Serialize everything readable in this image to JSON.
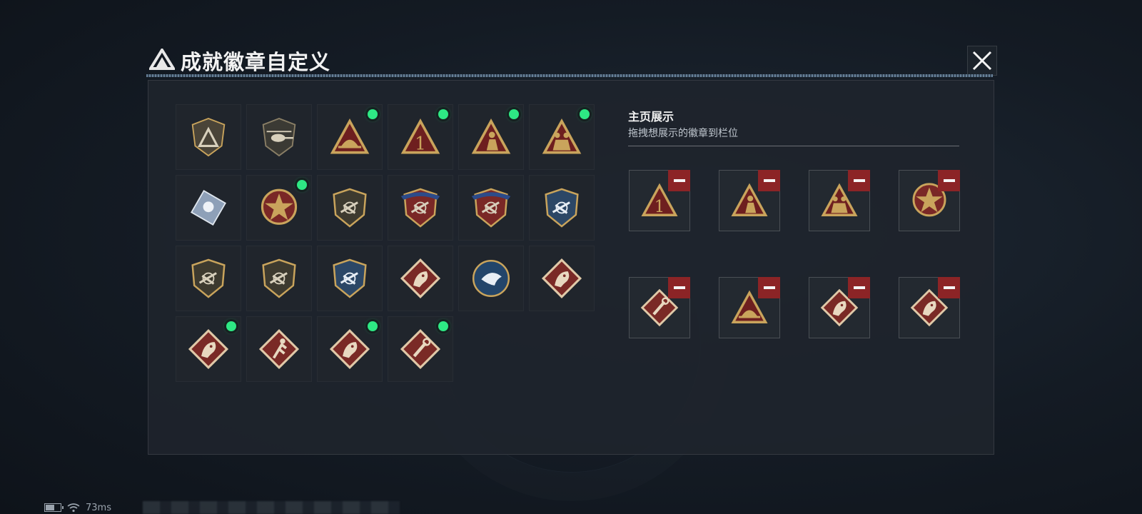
{
  "header": {
    "title": "成就徽章自定义"
  },
  "display": {
    "title": "主页展示",
    "subtitle": "拖拽想展示的徽章到栏位"
  },
  "status": {
    "ping": "73ms"
  },
  "colors": {
    "new_dot": "#2ee884",
    "remove": "#8c2426"
  },
  "badges": [
    {
      "icon": "triangle-shield-badge-icon",
      "new": false
    },
    {
      "icon": "helicopter-badge-icon",
      "new": false
    },
    {
      "icon": "gold-triangle-hat-badge-icon",
      "new": true
    },
    {
      "icon": "gold-triangle-number-one-badge-icon",
      "new": true
    },
    {
      "icon": "gold-triangle-soldier-badge-icon",
      "new": true
    },
    {
      "icon": "gold-triangle-squad-badge-icon",
      "new": true
    },
    {
      "icon": "silver-gem-badge-icon",
      "new": false
    },
    {
      "icon": "star-emblem-badge-icon",
      "new": true
    },
    {
      "icon": "chevron-shield-badge-icon",
      "new": false
    },
    {
      "icon": "winged-star-shield-badge-icon",
      "new": false
    },
    {
      "icon": "red-diamond-shield-badge-icon",
      "new": false
    },
    {
      "icon": "crosshair-rifle-shield-badge-icon",
      "new": false
    },
    {
      "icon": "rifle-shield-badge-icon",
      "new": false
    },
    {
      "icon": "smg-shield-badge-icon",
      "new": false
    },
    {
      "icon": "crossed-bullets-shield-badge-icon",
      "new": false
    },
    {
      "icon": "wolf-diamond-badge-icon",
      "new": false
    },
    {
      "icon": "eagle-medallion-badge-icon",
      "new": false
    },
    {
      "icon": "dragon-diamond-badge-icon",
      "new": false
    },
    {
      "icon": "dragon-diamond-badge-icon",
      "new": true
    },
    {
      "icon": "runner-diamond-badge-icon",
      "new": false
    },
    {
      "icon": "horse-diamond-badge-icon",
      "new": true
    },
    {
      "icon": "wrench-diamond-badge-icon",
      "new": true
    }
  ],
  "showcase_slots": [
    {
      "icon": "gold-triangle-number-one-badge-icon"
    },
    {
      "icon": "gold-triangle-soldier-badge-icon"
    },
    {
      "icon": "gold-triangle-squad-badge-icon"
    },
    {
      "icon": "star-emblem-badge-icon"
    },
    {
      "icon": "wrench-diamond-badge-icon"
    },
    {
      "icon": "gold-triangle-hat-badge-icon"
    },
    {
      "icon": "horse-diamond-badge-icon"
    },
    {
      "icon": "dragon-diamond-badge-icon"
    }
  ]
}
